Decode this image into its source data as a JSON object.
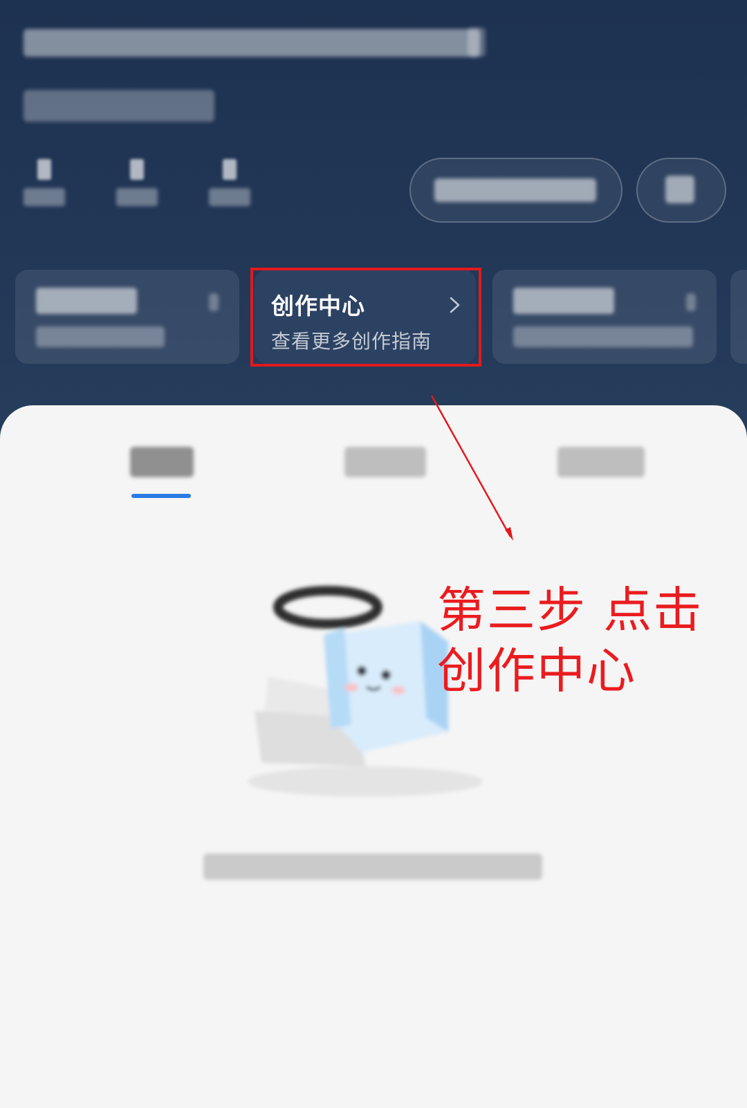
{
  "profile": {
    "bio_text": "",
    "tag_text": ""
  },
  "stats": [
    {
      "value": "",
      "label": ""
    },
    {
      "value": "",
      "label": ""
    },
    {
      "value": "",
      "label": ""
    }
  ],
  "creation_center": {
    "title": "创作中心",
    "subtitle": "查看更多创作指南",
    "chevron_icon": "chevron-right-icon"
  },
  "tabs": {
    "active_index": 0,
    "underline_color": "#2b7be5"
  },
  "annotation": {
    "text": "第三步 点击创作中心",
    "color": "#ea1c1f"
  },
  "colors": {
    "header_bg": "#1d3150",
    "sheet_bg": "#f5f5f5",
    "highlight": "#e3191c"
  },
  "empty_state": {
    "illustration_icon": "cute-box-character-icon"
  }
}
